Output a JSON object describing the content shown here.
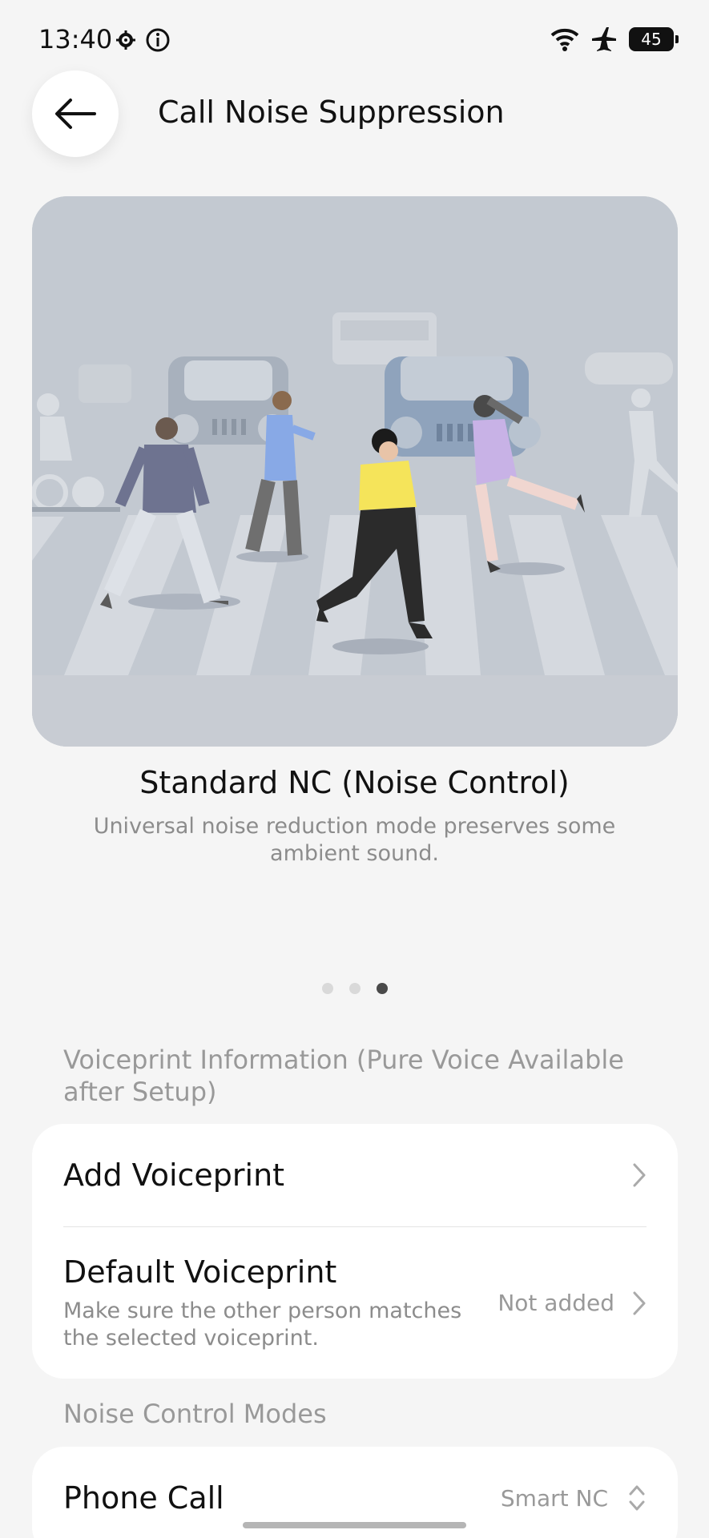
{
  "status_bar": {
    "time": "13:40",
    "battery": "45",
    "icons_left": [
      "settings-icon",
      "info-icon"
    ],
    "icons_right": [
      "wifi-icon",
      "airplane-icon",
      "battery-icon"
    ]
  },
  "header": {
    "title": "Call Noise Suppression"
  },
  "carousel": {
    "mode_title": "Standard NC (Noise Control)",
    "mode_description": "Universal noise reduction mode preserves some ambient sound.",
    "page_count": 3,
    "active_page": 3
  },
  "voiceprint_section": {
    "header": "Voiceprint Information (Pure Voice Available after Setup)",
    "items": [
      {
        "title": "Add Voiceprint"
      },
      {
        "title": "Default Voiceprint",
        "subtitle": "Make sure the other person matches the selected voiceprint.",
        "value": "Not added"
      }
    ]
  },
  "noise_modes_section": {
    "header": "Noise Control Modes",
    "items": [
      {
        "title": "Phone Call",
        "value": "Smart NC"
      }
    ]
  },
  "colors": {
    "background": "#f5f5f5",
    "card": "#ffffff",
    "illustration_bg": "#c3c9d1",
    "secondary_text": "#8c8c8c"
  }
}
